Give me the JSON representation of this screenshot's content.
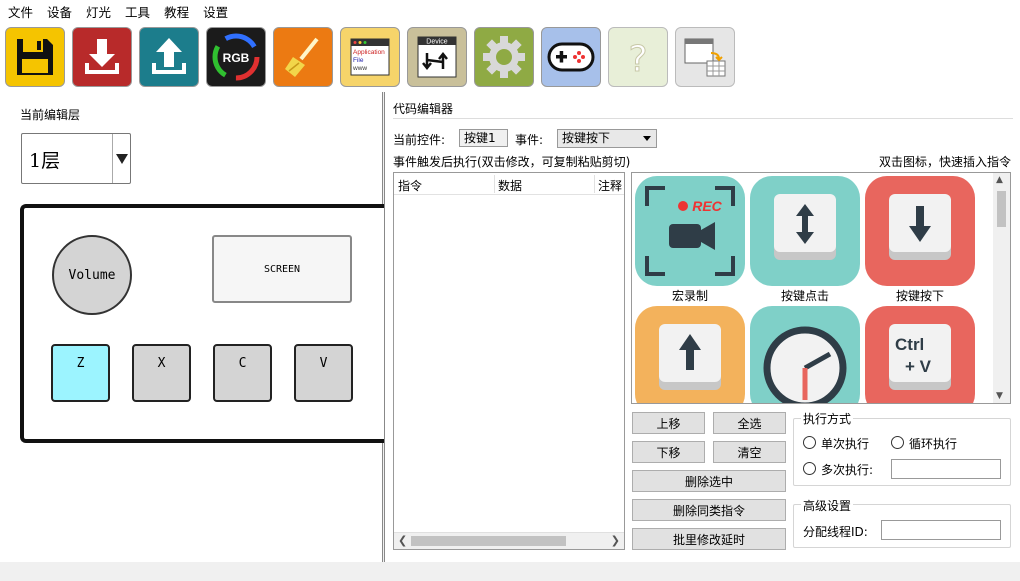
{
  "menu": [
    "文件",
    "设备",
    "灯光",
    "工具",
    "教程",
    "设置"
  ],
  "toolbar": {
    "rgb_label": "RGB",
    "app_file_lines": [
      "Application",
      "File",
      "www"
    ],
    "device_label": "Device"
  },
  "left": {
    "layer_label": "当前编辑层",
    "layer_value": "1层",
    "panel": {
      "knob": "Volume",
      "screen": "SCREEN",
      "keys": [
        "Z",
        "X",
        "C",
        "V"
      ]
    }
  },
  "editor": {
    "title": "代码编辑器",
    "control_label": "当前控件:",
    "control_value": "按键1",
    "event_label": "事件:",
    "event_value": "按键按下",
    "hint_left": "事件触发后执行(双击修改，可复制粘贴剪切)",
    "hint_right": "双击图标，快速插入指令",
    "columns": [
      "指令",
      "数据",
      "注释"
    ],
    "icons": [
      {
        "label": "宏录制",
        "rec_text": "REC"
      },
      {
        "label": "按键点击"
      },
      {
        "label": "按键按下"
      },
      {
        "label": ""
      },
      {
        "label": ""
      },
      {
        "label": "",
        "ctrl_text": "Ctrl",
        "plus_text": "+ V"
      }
    ],
    "buttons": {
      "move_up": "上移",
      "select_all": "全选",
      "move_down": "下移",
      "clear": "清空",
      "delete_selected": "删除选中",
      "delete_same": "删除同类指令",
      "batch_delay": "批里修改延时"
    },
    "exec": {
      "group_title": "执行方式",
      "single": "单次执行",
      "loop": "循环执行",
      "multi": "多次执行:",
      "multi_value": ""
    },
    "advanced": {
      "group_title": "高级设置",
      "thread_label": "分配线程ID:",
      "thread_value": ""
    }
  },
  "colors": {
    "active_key": "#9cf4ff",
    "icon_teal": "#7fd0c8",
    "icon_red": "#e8665e",
    "icon_orange": "#f3b25c"
  }
}
